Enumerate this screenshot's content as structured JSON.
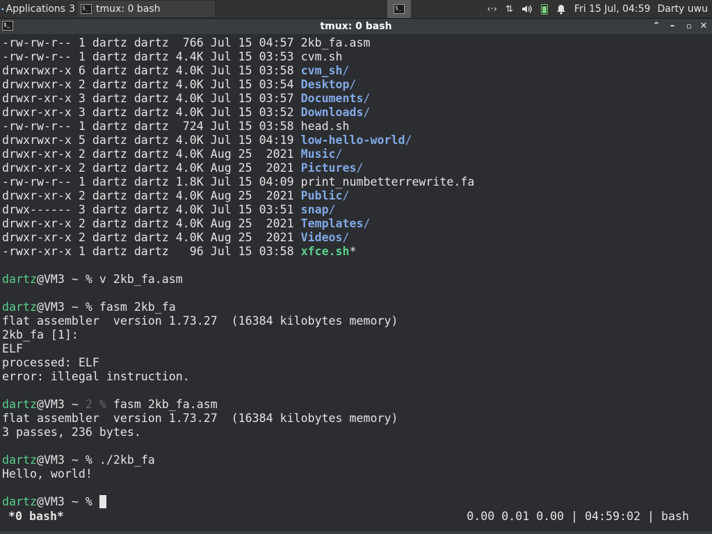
{
  "panel": {
    "applications_label": "Applications",
    "applications_suffix": "3",
    "task_label": "tmux: 0 bash",
    "clock": "Fri 15 Jul, 04:59",
    "user": "Darty uwu"
  },
  "window": {
    "title": "tmux: 0 bash"
  },
  "terminal": {
    "listing": [
      {
        "meta": "-rw-rw-r-- 1 dartz dartz  766 Jul 15 04:57 ",
        "name": "2kb_fa.asm",
        "kind": "file",
        "suffix": ""
      },
      {
        "meta": "-rw-rw-r-- 1 dartz dartz 4.4K Jul 15 03:53 ",
        "name": "cvm.sh",
        "kind": "file",
        "suffix": ""
      },
      {
        "meta": "drwxrwxr-x 6 dartz dartz 4.0K Jul 15 03:58 ",
        "name": "cvm_sh",
        "kind": "dir",
        "suffix": "/"
      },
      {
        "meta": "drwxrwxr-x 2 dartz dartz 4.0K Jul 15 03:54 ",
        "name": "Desktop",
        "kind": "dir",
        "suffix": "/"
      },
      {
        "meta": "drwxr-xr-x 3 dartz dartz 4.0K Jul 15 03:57 ",
        "name": "Documents",
        "kind": "dir",
        "suffix": "/"
      },
      {
        "meta": "drwxr-xr-x 3 dartz dartz 4.0K Jul 15 03:52 ",
        "name": "Downloads",
        "kind": "dir",
        "suffix": "/"
      },
      {
        "meta": "-rw-rw-r-- 1 dartz dartz  724 Jul 15 03:58 ",
        "name": "head.sh",
        "kind": "file",
        "suffix": ""
      },
      {
        "meta": "drwxrwxr-x 5 dartz dartz 4.0K Jul 15 04:19 ",
        "name": "low-hello-world",
        "kind": "dir",
        "suffix": "/"
      },
      {
        "meta": "drwxr-xr-x 2 dartz dartz 4.0K Aug 25  2021 ",
        "name": "Music",
        "kind": "dir",
        "suffix": "/"
      },
      {
        "meta": "drwxr-xr-x 2 dartz dartz 4.0K Aug 25  2021 ",
        "name": "Pictures",
        "kind": "dir",
        "suffix": "/"
      },
      {
        "meta": "-rw-rw-r-- 1 dartz dartz 1.8K Jul 15 04:09 ",
        "name": "print_numbetterrewrite.fa",
        "kind": "file",
        "suffix": ""
      },
      {
        "meta": "drwxr-xr-x 2 dartz dartz 4.0K Aug 25  2021 ",
        "name": "Public",
        "kind": "dir",
        "suffix": "/"
      },
      {
        "meta": "drwx------ 3 dartz dartz 4.0K Jul 15 03:51 ",
        "name": "snap",
        "kind": "dir",
        "suffix": "/"
      },
      {
        "meta": "drwxr-xr-x 2 dartz dartz 4.0K Aug 25  2021 ",
        "name": "Templates",
        "kind": "dir",
        "suffix": "/"
      },
      {
        "meta": "drwxr-xr-x 2 dartz dartz 4.0K Aug 25  2021 ",
        "name": "Videos",
        "kind": "dir",
        "suffix": "/"
      },
      {
        "meta": "-rwxr-xr-x 1 dartz dartz   96 Jul 15 03:58 ",
        "name": "xfce.sh",
        "kind": "exe",
        "suffix": "*"
      }
    ],
    "prompt_user": "dartz",
    "prompt_host": "@VM3 ~ ",
    "cmd1": "% v 2kb_fa.asm",
    "cmd2": "% fasm 2kb_fa",
    "out2": [
      "flat assembler  version 1.73.27  (16384 kilobytes memory)",
      "2kb_fa [1]:",
      "ELF",
      "processed: ELF",
      "error: illegal instruction."
    ],
    "cmd3_status": "2 %",
    "cmd3": " fasm 2kb_fa.asm",
    "out3": [
      "flat assembler  version 1.73.27  (16384 kilobytes memory)",
      "3 passes, 236 bytes."
    ],
    "cmd4": "% ./2kb_fa",
    "out4": "Hello, world!",
    "cmd5": "% "
  },
  "tmux": {
    "window_label": "*0 bash*",
    "status_right": "0.00 0.01 0.00 | 04:59:02 | bash"
  }
}
